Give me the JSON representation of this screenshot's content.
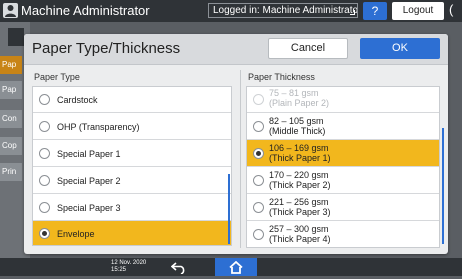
{
  "top_bar": {
    "title": "Machine Administrator",
    "login_status": "Logged in: Machine Administrator",
    "help_label": "?",
    "logout_label": "Logout",
    "edge_glyph": "("
  },
  "background": {
    "tabs": [
      "Pap",
      "Pap",
      "Con",
      "Cop",
      "Prin"
    ]
  },
  "dialog": {
    "title": "Paper Type/Thickness",
    "cancel_label": "Cancel",
    "ok_label": "OK",
    "paper_type": {
      "label": "Paper Type",
      "items": [
        {
          "label": "Cardstock",
          "selected": false
        },
        {
          "label": "OHP (Transparency)",
          "selected": false
        },
        {
          "label": "Special Paper 1",
          "selected": false
        },
        {
          "label": "Special Paper 2",
          "selected": false
        },
        {
          "label": "Special Paper 3",
          "selected": false
        },
        {
          "label": "Envelope",
          "selected": true
        }
      ]
    },
    "paper_thickness": {
      "label": "Paper Thickness",
      "items": [
        {
          "range": "75 – 81 gsm",
          "name": "(Plain Paper 2)",
          "selected": false,
          "disabled": true
        },
        {
          "range": "82 – 105 gsm",
          "name": "(Middle Thick)",
          "selected": false,
          "disabled": false
        },
        {
          "range": "106 – 169 gsm",
          "name": "(Thick Paper 1)",
          "selected": true,
          "disabled": false
        },
        {
          "range": "170 – 220 gsm",
          "name": "(Thick Paper 2)",
          "selected": false,
          "disabled": false
        },
        {
          "range": "221 – 256 gsm",
          "name": "(Thick Paper 3)",
          "selected": false,
          "disabled": false
        },
        {
          "range": "257 – 300 gsm",
          "name": "(Thick Paper 4)",
          "selected": false,
          "disabled": false
        }
      ]
    }
  },
  "bottom_bar": {
    "date": "12 Nov. 2020",
    "time": "15:25"
  },
  "colors": {
    "accent_blue": "#2d6fd3",
    "selected_yellow": "#f2b71d"
  },
  "icons": {
    "user": "user-icon",
    "back": "back-arrow-icon",
    "home": "home-icon"
  }
}
